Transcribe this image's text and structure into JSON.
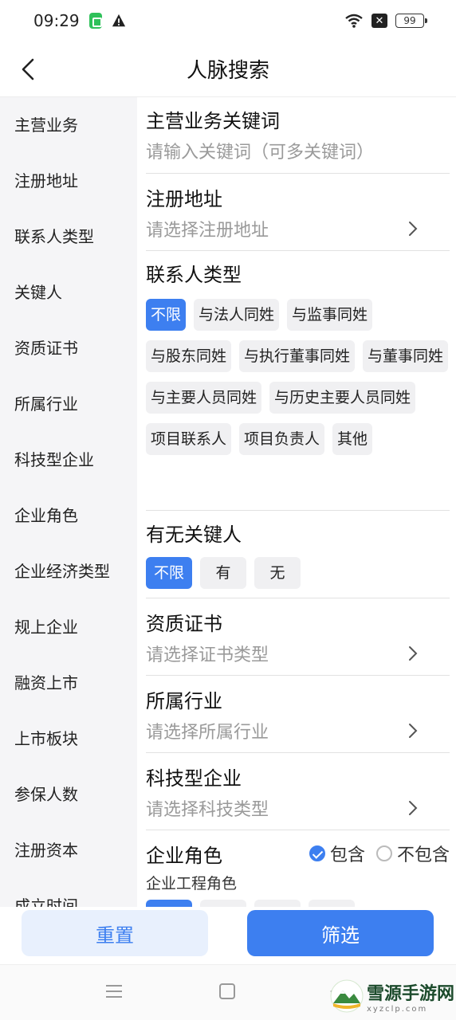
{
  "status": {
    "time": "09:29",
    "battery": "99"
  },
  "header": {
    "title": "人脉搜索"
  },
  "sidebar": {
    "items": [
      {
        "label": "主营业务"
      },
      {
        "label": "注册地址"
      },
      {
        "label": "联系人类型"
      },
      {
        "label": "关键人"
      },
      {
        "label": "资质证书"
      },
      {
        "label": "所属行业"
      },
      {
        "label": "科技型企业"
      },
      {
        "label": "企业角色"
      },
      {
        "label": "企业经济类型"
      },
      {
        "label": "规上企业"
      },
      {
        "label": "融资上市"
      },
      {
        "label": "上市板块"
      },
      {
        "label": "参保人数"
      },
      {
        "label": "注册资本"
      },
      {
        "label": "成立时间"
      }
    ]
  },
  "main": {
    "business": {
      "title": "主营业务关键词",
      "placeholder": "请输入关键词（可多关键词）"
    },
    "address": {
      "title": "注册地址",
      "placeholder": "请选择注册地址"
    },
    "contact_type": {
      "title": "联系人类型",
      "options": [
        "不限",
        "与法人同姓",
        "与监事同姓",
        "与股东同姓",
        "与执行董事同姓",
        "与董事同姓",
        "与主要人员同姓",
        "与历史主要人员同姓",
        "项目联系人",
        "项目负责人",
        "其他"
      ],
      "selected": "不限"
    },
    "key_person": {
      "title": "有无关键人",
      "options": [
        "不限",
        "有",
        "无"
      ],
      "selected": "不限"
    },
    "certificate": {
      "title": "资质证书",
      "placeholder": "请选择证书类型"
    },
    "industry": {
      "title": "所属行业",
      "placeholder": "请选择所属行业"
    },
    "tech": {
      "title": "科技型企业",
      "placeholder": "请选择科技类型"
    },
    "role": {
      "title": "企业角色",
      "include_label": "包含",
      "exclude_label": "不包含",
      "include_checked": true,
      "subtitle": "企业工程角色"
    }
  },
  "buttons": {
    "reset": "重置",
    "filter": "筛选"
  },
  "watermark": {
    "main": "雪源手游网",
    "sub": "xyzclp.com"
  },
  "colors": {
    "accent": "#3d7ff0",
    "chip_bg": "#f0f0f2",
    "sidebar_bg": "#f5f5f7"
  }
}
